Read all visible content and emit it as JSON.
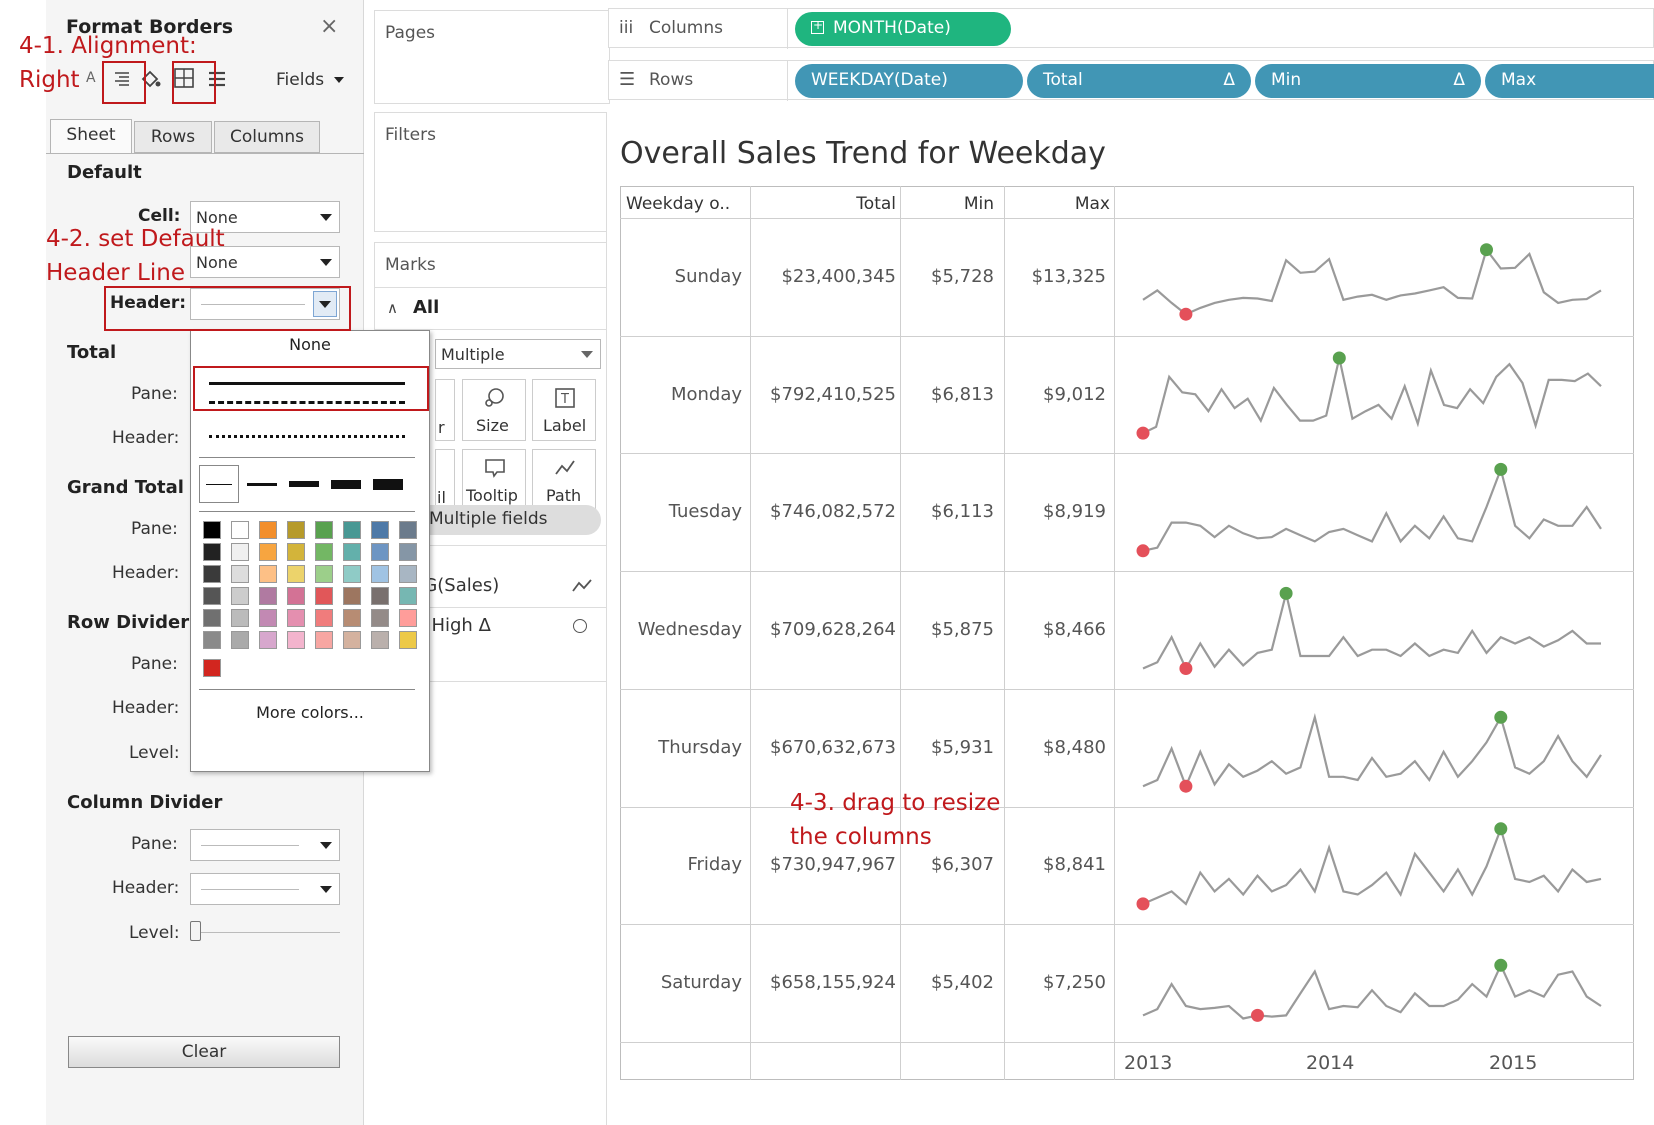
{
  "format_panel": {
    "title": "Format Borders",
    "close": "×",
    "fields_label": "Fields",
    "tabs": [
      "Sheet",
      "Rows",
      "Columns"
    ],
    "default_heading": "Default",
    "cell_label": "Cell:",
    "cell_value": "None",
    "pane_label": "Pane:",
    "pane_value": "None",
    "header_label": "Header:",
    "total_heading": "Total",
    "grand_total_heading": "Grand Total",
    "row_divider_heading": "Row Divider",
    "column_divider_heading": "Column Divider",
    "level_label": "Level:",
    "clear_button": "Clear",
    "short_pane": "Pane:",
    "short_header": "Header:"
  },
  "dropdown": {
    "none_label": "None",
    "more_colors": "More colors...",
    "colors": {
      "col1": [
        "#000000",
        "#222222",
        "#3a3a3a",
        "#555555",
        "#707070",
        "#8a8a8a"
      ],
      "col2": [
        "#ffffff",
        "#f0f0f0",
        "#dddddd",
        "#cccccc",
        "#bbbbbb",
        "#aaaaaa"
      ],
      "accent": "#d2261f"
    }
  },
  "shelves": {
    "pages": "Pages",
    "filters": "Filters",
    "marks": "Marks",
    "marks_all": "All",
    "mark_type": "Multiple",
    "size": "Size",
    "label": "Label",
    "tooltip": "Tooltip",
    "path": "Path",
    "color_partial": "r",
    "detail_partial": "il",
    "multiple_fields": "Multiple fields",
    "avg_sales": "VG(Sales)",
    "window_high": "w High",
    "delta": "Δ",
    "columns_label": "Columns",
    "rows_label": "Rows",
    "columns_pill": "MONTH(Date)",
    "rows_pills": [
      "WEEKDAY(Date)",
      "Total",
      "Min",
      "Max"
    ]
  },
  "viz": {
    "title": "Overall Sales Trend for Weekday",
    "headers": [
      "Weekday o..",
      "Total",
      "Min",
      "Max"
    ],
    "rows": [
      {
        "day": "Sunday",
        "total": "$23,400,345",
        "min": "$5,728",
        "max": "$13,325"
      },
      {
        "day": "Monday",
        "total": "$792,410,525",
        "min": "$6,813",
        "max": "$9,012"
      },
      {
        "day": "Tuesday",
        "total": "$746,082,572",
        "min": "$6,113",
        "max": "$8,919"
      },
      {
        "day": "Wednesday",
        "total": "$709,628,264",
        "min": "$5,875",
        "max": "$8,466"
      },
      {
        "day": "Thursday",
        "total": "$670,632,673",
        "min": "$5,931",
        "max": "$8,480"
      },
      {
        "day": "Friday",
        "total": "$730,947,967",
        "min": "$6,307",
        "max": "$8,841"
      },
      {
        "day": "Saturday",
        "total": "$658,155,924",
        "min": "$5,402",
        "max": "$7,250"
      }
    ],
    "axis_years": [
      "2013",
      "2014",
      "2015"
    ]
  },
  "chart_data": {
    "type": "line",
    "series": [
      {
        "name": "Sunday",
        "values": [
          0.35,
          0.5,
          0.3,
          0.12,
          0.22,
          0.3,
          0.35,
          0.38,
          0.37,
          0.33,
          0.98,
          0.78,
          0.8,
          1.0,
          0.35,
          0.4,
          0.43,
          0.35,
          0.42,
          0.45,
          0.5,
          0.55,
          0.38,
          0.37,
          1.15,
          0.85,
          0.86,
          1.08,
          0.47,
          0.3,
          0.35,
          0.36,
          0.5
        ],
        "min_index": 3,
        "max_index": 24
      },
      {
        "name": "Monday",
        "values": [
          0.1,
          0.2,
          1.0,
          0.75,
          0.72,
          0.45,
          0.8,
          0.5,
          0.65,
          0.3,
          0.82,
          0.55,
          0.3,
          0.3,
          0.38,
          1.3,
          0.33,
          0.45,
          0.55,
          0.33,
          0.85,
          0.25,
          1.1,
          0.55,
          0.5,
          0.8,
          0.58,
          1.0,
          1.2,
          0.9,
          0.22,
          0.95,
          0.95,
          0.93,
          1.05,
          0.85
        ],
        "min_index": 0,
        "max_index": 15
      },
      {
        "name": "Tuesday",
        "values": [
          0.1,
          0.15,
          0.55,
          0.55,
          0.5,
          0.32,
          0.5,
          0.38,
          0.3,
          0.32,
          0.45,
          0.35,
          0.25,
          0.4,
          0.45,
          0.35,
          0.25,
          0.7,
          0.25,
          0.5,
          0.3,
          0.65,
          0.3,
          0.25,
          0.8,
          1.4,
          0.5,
          0.3,
          0.6,
          0.5,
          0.5,
          0.8,
          0.45
        ],
        "min_index": 0,
        "max_index": 25
      },
      {
        "name": "Wednesday",
        "values": [
          0.1,
          0.2,
          0.6,
          0.1,
          0.5,
          0.13,
          0.4,
          0.15,
          0.35,
          0.4,
          1.3,
          0.3,
          0.3,
          0.3,
          0.6,
          0.3,
          0.4,
          0.4,
          0.3,
          0.5,
          0.3,
          0.4,
          0.35,
          0.7,
          0.35,
          0.6,
          0.5,
          0.6,
          0.45,
          0.55,
          0.7,
          0.5,
          0.5
        ],
        "min_index": 3,
        "max_index": 10
      },
      {
        "name": "Thursday",
        "values": [
          0.1,
          0.2,
          0.7,
          0.1,
          0.65,
          0.13,
          0.45,
          0.25,
          0.35,
          0.5,
          0.3,
          0.4,
          1.2,
          0.25,
          0.25,
          0.2,
          0.55,
          0.25,
          0.3,
          0.5,
          0.2,
          0.65,
          0.25,
          0.5,
          0.8,
          1.2,
          0.4,
          0.3,
          0.5,
          0.9,
          0.5,
          0.25,
          0.6
        ],
        "min_index": 3,
        "max_index": 25
      },
      {
        "name": "Friday",
        "values": [
          0.1,
          0.2,
          0.3,
          0.1,
          0.6,
          0.3,
          0.5,
          0.25,
          0.55,
          0.3,
          0.4,
          0.65,
          0.3,
          1.0,
          0.3,
          0.25,
          0.4,
          0.6,
          0.25,
          0.9,
          0.6,
          0.3,
          0.65,
          0.25,
          0.7,
          1.3,
          0.5,
          0.45,
          0.55,
          0.3,
          0.65,
          0.45,
          0.5
        ],
        "min_index": 0,
        "max_index": 25
      },
      {
        "name": "Saturday",
        "values": [
          0.2,
          0.3,
          0.7,
          0.35,
          0.3,
          0.32,
          0.35,
          0.15,
          0.2,
          0.18,
          0.2,
          0.55,
          0.9,
          0.3,
          0.35,
          0.33,
          0.6,
          0.35,
          0.25,
          0.55,
          0.35,
          0.35,
          0.45,
          0.7,
          0.5,
          1.0,
          0.5,
          0.6,
          0.5,
          0.85,
          0.9,
          0.5,
          0.35
        ],
        "min_index": 8,
        "max_index": 25
      }
    ],
    "x_axis_labels": [
      "2013",
      "2014",
      "2015"
    ],
    "line_color": "#9a9a9a",
    "min_marker_color": "#e4505a",
    "max_marker_color": "#59a14f"
  },
  "annotations": {
    "a1_line1": "4-1. Alignment:",
    "a1_line2": "Right",
    "a2_line1": "4-2. set Default",
    "a2_line2": "Header Line",
    "a3_line1": "4-3. drag to resize",
    "a3_line2": "the columns",
    "color": "#c0191c"
  }
}
